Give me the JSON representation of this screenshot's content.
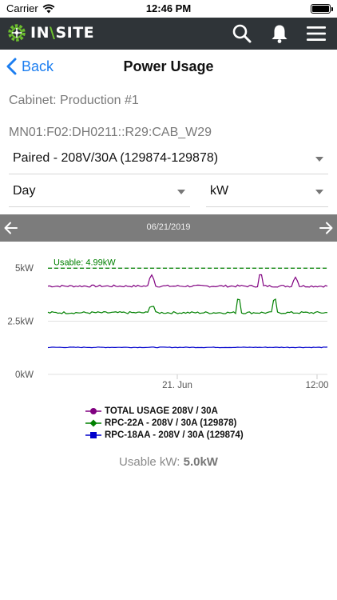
{
  "status_bar": {
    "carrier": "Carrier",
    "time": "12:46 PM"
  },
  "app_bar": {
    "logo": {
      "prefix": "IN",
      "slash": "\\",
      "suffix": "SITE"
    },
    "icons": [
      "search-icon",
      "bell-icon",
      "menu-icon"
    ]
  },
  "nav": {
    "back_label": "Back",
    "title": "Power Usage"
  },
  "cabinet": {
    "label": "Cabinet: Production #1",
    "location": "MN01:F02:DH0211::R29:CAB_W29"
  },
  "selectors": {
    "circuit": "Paired - 208V/30A (129874-129878)",
    "period": "Day",
    "unit": "kW"
  },
  "date_nav": {
    "date": "06/21/2019"
  },
  "colors": {
    "total": "#800080",
    "rpc22a": "#008000",
    "rpc18aa": "#0000cc",
    "usable": "#008000",
    "date_bar": "#7c7c7c",
    "app_bar": "#2f3438",
    "accent": "#1c7ef0"
  },
  "chart_data": {
    "type": "line",
    "y_ticks": [
      "0kW",
      "2.5kW",
      "5kW"
    ],
    "ylim": [
      0,
      5.5
    ],
    "x_ticks": [
      "21. Jun",
      "12:00"
    ],
    "threshold": {
      "label": "Usable: 4.99kW",
      "value": 4.99
    },
    "series": [
      {
        "name": "TOTAL USAGE 208V / 30A",
        "base": 4.15,
        "jitter": 0.05,
        "spikes": [
          0.35,
          0.3,
          0.25
        ]
      },
      {
        "name": "RPC-22A - 208V / 30A (129878)",
        "base": 2.9,
        "jitter": 0.05,
        "spikes": [
          0.4,
          0.35,
          0.3
        ]
      },
      {
        "name": "RPC-18AA - 208V / 30A (129874)",
        "base": 1.27,
        "jitter": 0.015,
        "spikes": []
      }
    ]
  },
  "footer": {
    "usable_label": "Usable kW:",
    "usable_value": "5.0kW"
  }
}
